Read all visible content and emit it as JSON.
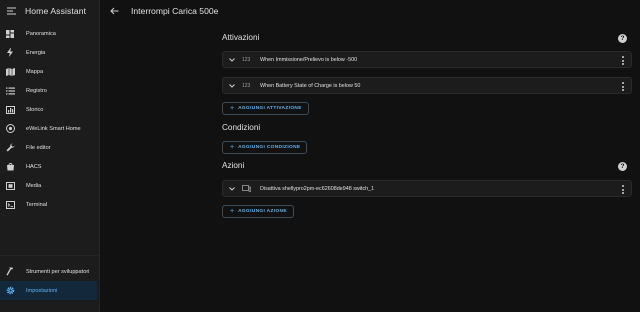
{
  "app": {
    "title": "Home Assistant"
  },
  "sidebar": {
    "items": [
      {
        "label": "Panoramica",
        "icon": "dashboard-icon"
      },
      {
        "label": "Energia",
        "icon": "lightning-icon"
      },
      {
        "label": "Mappa",
        "icon": "map-icon"
      },
      {
        "label": "Registro",
        "icon": "list-icon"
      },
      {
        "label": "Storico",
        "icon": "chart-icon"
      },
      {
        "label": "eWeLink Smart Home",
        "icon": "ewelink-icon"
      },
      {
        "label": "File editor",
        "icon": "wrench-icon"
      },
      {
        "label": "HACS",
        "icon": "hacs-icon"
      },
      {
        "label": "Media",
        "icon": "media-icon"
      },
      {
        "label": "Terminal",
        "icon": "terminal-icon"
      }
    ],
    "bottom": [
      {
        "label": "Strumenti per sviluppatori",
        "icon": "hammer-icon"
      },
      {
        "label": "Impostazioni",
        "icon": "gear-icon",
        "active": true
      }
    ]
  },
  "header": {
    "title": "Interrompi Carica 500e"
  },
  "triggers": {
    "title": "Attivazioni",
    "items": [
      {
        "type_icon": "123",
        "text": "When Immissione/Prelievo is below -500"
      },
      {
        "type_icon": "123",
        "text": "When Battery State of Charge is below 50"
      }
    ],
    "add_label": "AGGIUNGI ATTIVAZIONE"
  },
  "conditions": {
    "title": "Condizioni",
    "add_label": "AGGIUNGI CONDIZIONE"
  },
  "actions": {
    "title": "Azioni",
    "items": [
      {
        "type_icon": "device-icon",
        "text": "Disattiva shellypro2pm-ec62608de948 switch_1"
      }
    ],
    "add_label": "AGGIUNGI AZIONE"
  },
  "colors": {
    "accent": "#62b3f3",
    "background": "#111111",
    "card": "#1c1c1c",
    "sidebar": "#1c1c1c"
  }
}
